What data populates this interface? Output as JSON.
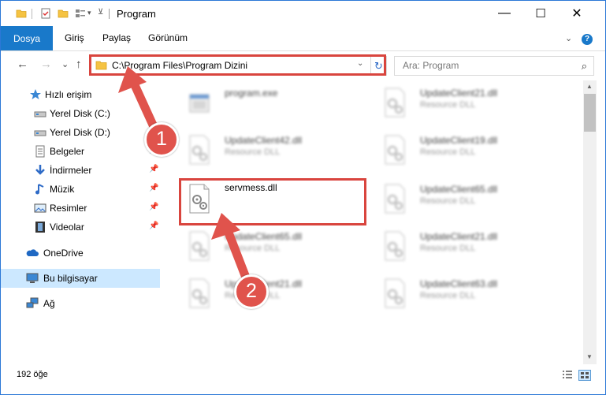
{
  "window": {
    "title": "Program",
    "controls": {
      "minimize": "—",
      "maximize": "☐",
      "close": "✕"
    }
  },
  "ribbon": {
    "tabs": [
      "Dosya",
      "Giriş",
      "Paylaş",
      "Görünüm"
    ],
    "collapse": "⌄",
    "help": "?"
  },
  "nav": {
    "back": "←",
    "forward": "→",
    "recent": "⌄",
    "up": "↑",
    "address": "C:\\Program Files\\Program Dizini",
    "address_dropdown": "⌄",
    "refresh": "↻",
    "search_placeholder": "Ara: Program",
    "search_icon": "⌕"
  },
  "sidebar": {
    "items": [
      {
        "label": "Hızlı erişim",
        "icon": "star-icon"
      },
      {
        "label": "Yerel Disk (C:)",
        "icon": "drive-icon"
      },
      {
        "label": "Yerel Disk (D:)",
        "icon": "drive-icon"
      },
      {
        "label": "Belgeler",
        "icon": "documents-icon",
        "pinned": true
      },
      {
        "label": "İndirmeler",
        "icon": "download-icon",
        "pinned": true
      },
      {
        "label": "Müzik",
        "icon": "music-icon",
        "pinned": true
      },
      {
        "label": "Resimler",
        "icon": "pictures-icon",
        "pinned": true
      },
      {
        "label": "Videolar",
        "icon": "videos-icon",
        "pinned": true
      },
      {
        "label": "OneDrive",
        "icon": "cloud-icon"
      },
      {
        "label": "Bu bilgisayar",
        "icon": "computer-icon",
        "selected": true
      },
      {
        "label": "Ağ",
        "icon": "network-icon"
      }
    ],
    "pin_glyph": "📌"
  },
  "files": [
    {
      "name": "program.exe",
      "type": "",
      "kind": "exe",
      "blurred": true
    },
    {
      "name": "UpdateClient21.dll",
      "type": "Resource DLL",
      "kind": "dll",
      "blurred": true
    },
    {
      "name": "UpdateClient42.dll",
      "type": "Resource DLL",
      "kind": "dll",
      "blurred": true
    },
    {
      "name": "UpdateClient19.dll",
      "type": "Resource DLL",
      "kind": "dll",
      "blurred": true
    },
    {
      "name": "servmess.dll",
      "type": "",
      "kind": "dll",
      "blurred": false
    },
    {
      "name": "UpdateClient65.dll",
      "type": "Resource DLL",
      "kind": "dll",
      "blurred": true
    },
    {
      "name": "UpdateClient65.dll",
      "type": "Resource DLL",
      "kind": "dll",
      "blurred": true
    },
    {
      "name": "UpdateClient21.dll",
      "type": "Resource DLL",
      "kind": "dll",
      "blurred": true
    },
    {
      "name": "UpdateClient21.dll",
      "type": "Resource DLL",
      "kind": "dll",
      "blurred": true
    },
    {
      "name": "UpdateClient63.dll",
      "type": "Resource DLL",
      "kind": "dll",
      "blurred": true
    }
  ],
  "status": {
    "item_count": "192 öğe"
  },
  "annotations": {
    "badge1": "1",
    "badge2": "2",
    "highlight_color": "#d9453e",
    "badge_color": "#e0534c"
  },
  "colors": {
    "accent": "#1979ca",
    "selected_bg": "#cce8ff"
  }
}
